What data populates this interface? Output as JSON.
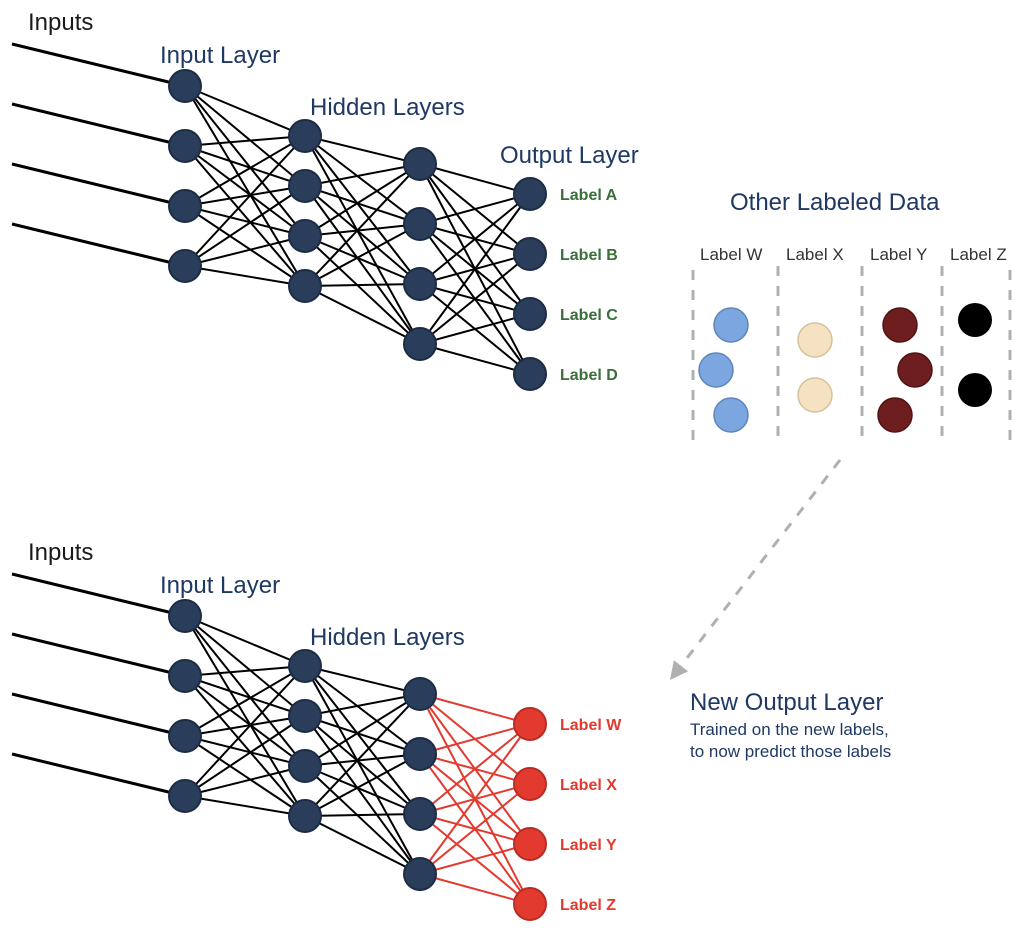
{
  "colors": {
    "node_navy": "#2a3e5c",
    "node_border": "#1c2c44",
    "edge_black": "#000000",
    "edge_red": "#e33a2f",
    "node_red": "#e33a2f",
    "data_blue": "#7ba6e0",
    "data_cream": "#f4e2c2",
    "data_maroon": "#6e1e1e",
    "data_black": "#000000",
    "dashed_gray": "#b0b0b0"
  },
  "top_net": {
    "inputs_title": "Inputs",
    "input_layer_title": "Input Layer",
    "hidden_title": "Hidden Layers",
    "output_title": "Output Layer",
    "output_labels": [
      "Label A",
      "Label B",
      "Label C",
      "Label D"
    ]
  },
  "other_data": {
    "title": "Other Labeled Data",
    "columns": [
      "Label W",
      "Label X",
      "Label Y",
      "Label Z"
    ]
  },
  "bottom_net": {
    "inputs_title": "Inputs",
    "input_layer_title": "Input Layer",
    "hidden_title": "Hidden Layers",
    "new_output_title": "New Output Layer",
    "new_output_sub1": "Trained on the new labels,",
    "new_output_sub2": "to now predict those labels",
    "output_labels": [
      "Label W",
      "Label X",
      "Label Y",
      "Label Z"
    ]
  }
}
